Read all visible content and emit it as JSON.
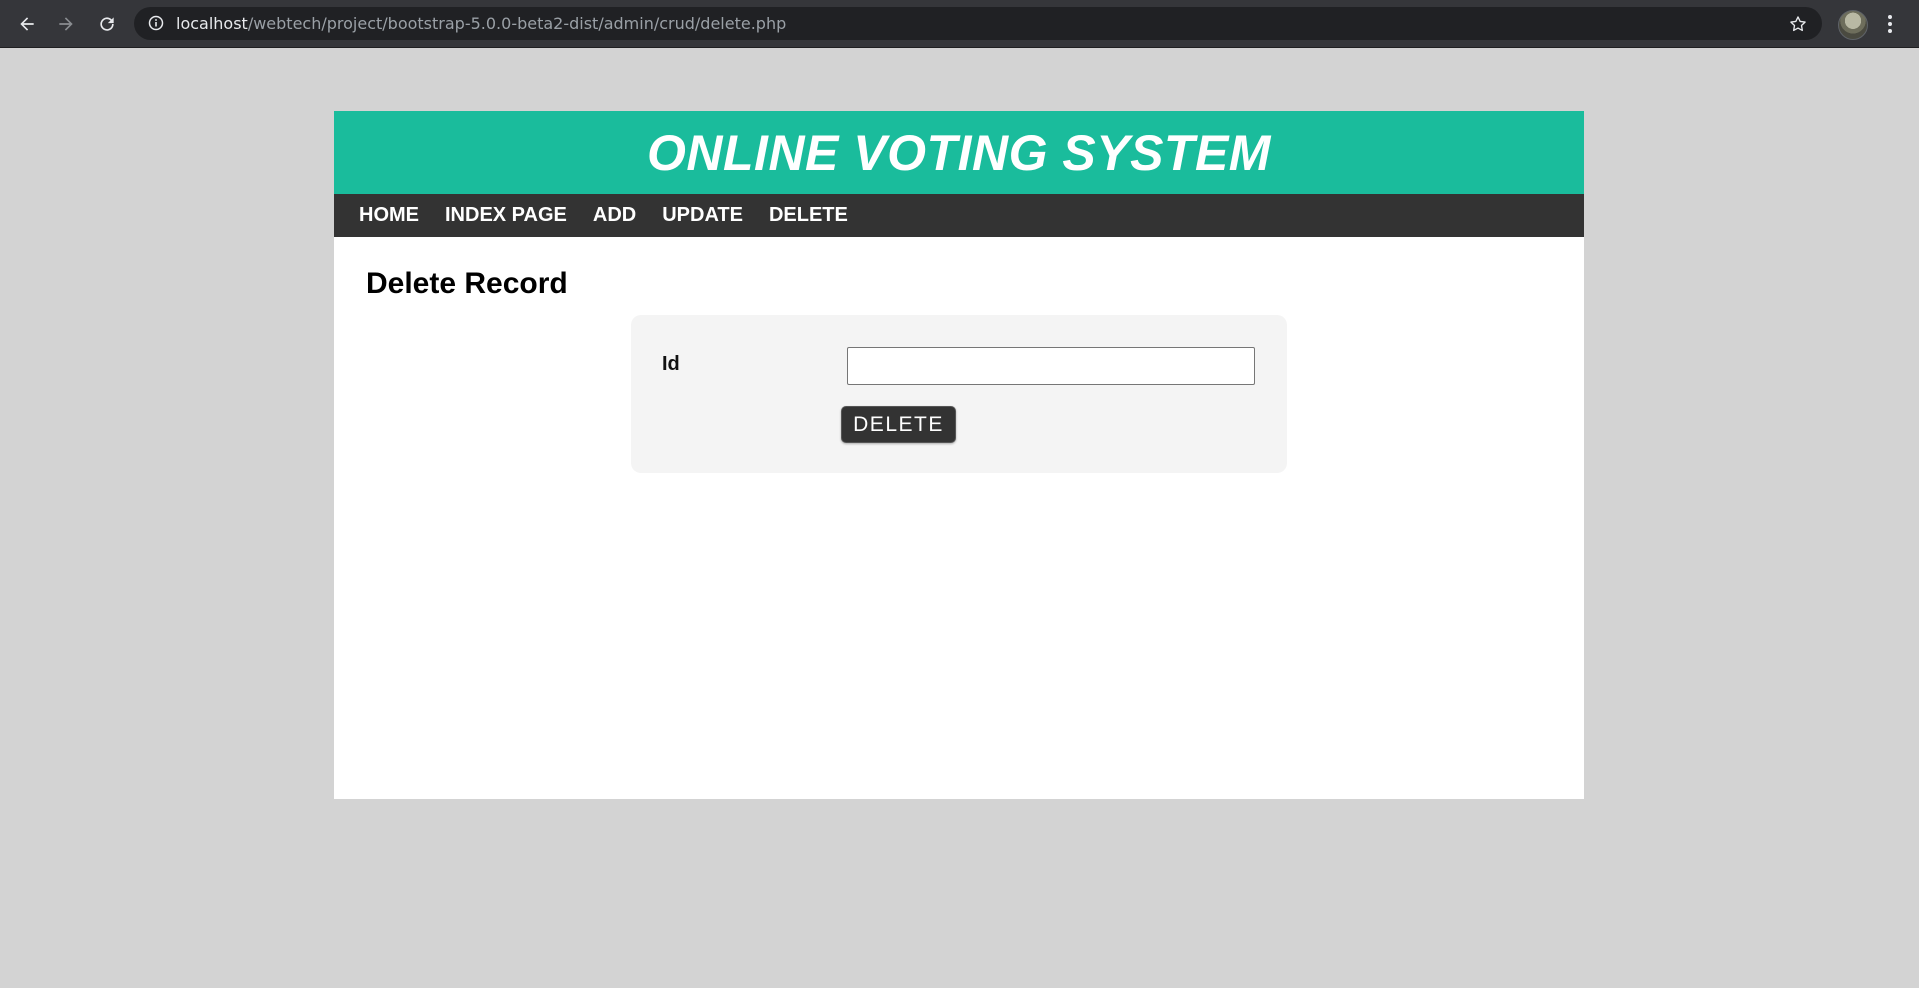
{
  "browser": {
    "url_host": "localhost",
    "url_path": "/webtech/project/bootstrap-5.0.0-beta2-dist/admin/crud/delete.php",
    "icons": [
      "back-arrow-icon",
      "forward-arrow-icon",
      "reload-icon",
      "info-icon",
      "star-icon",
      "profile-avatar",
      "menu-dots-icon"
    ]
  },
  "header": {
    "title": "ONLINE VOTING SYSTEM"
  },
  "nav": {
    "items": [
      "HOME",
      "INDEX PAGE",
      "ADD",
      "UPDATE",
      "DELETE"
    ]
  },
  "main": {
    "section_title": "Delete Record",
    "form": {
      "id_label": "Id",
      "id_value": "",
      "submit_label": "DELETE"
    }
  },
  "colors": {
    "header_bg": "#1abc9c",
    "nav_bg": "#333333",
    "page_bg": "#d3d3d3",
    "card_bg": "#f4f4f4"
  }
}
